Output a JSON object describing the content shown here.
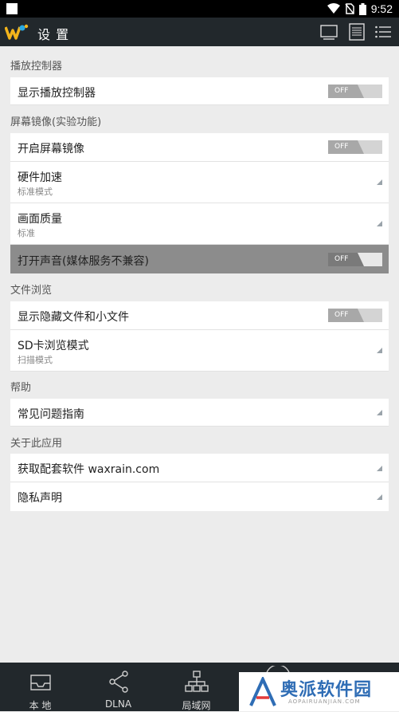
{
  "status_bar": {
    "time": "9:52"
  },
  "app_bar": {
    "title": "设 置"
  },
  "sections": [
    {
      "header": "播放控制器",
      "rows": [
        {
          "label": "显示播放控制器",
          "toggle": "OFF"
        }
      ]
    },
    {
      "header": "屏幕镜像(实验功能)",
      "rows": [
        {
          "label": "开启屏幕镜像",
          "toggle": "OFF"
        },
        {
          "label": "硬件加速",
          "sub": "标准模式"
        },
        {
          "label": "画面质量",
          "sub": "标准"
        },
        {
          "label": "打开声音(媒体服务不兼容)",
          "toggle": "OFF",
          "disabled": true
        }
      ]
    },
    {
      "header": "文件浏览",
      "rows": [
        {
          "label": "显示隐藏文件和小文件",
          "toggle": "OFF"
        },
        {
          "label": "SD卡浏览模式",
          "sub": "扫描模式"
        }
      ]
    },
    {
      "header": "帮助",
      "rows": [
        {
          "label": "常见问题指南"
        }
      ]
    },
    {
      "header": "关于此应用",
      "rows": [
        {
          "label": "获取配套软件 waxrain.com"
        },
        {
          "label": "隐私声明"
        }
      ]
    }
  ],
  "bottom_nav": {
    "local": "本 地",
    "dlna": "DLNA",
    "lan": "局域网"
  },
  "watermark": {
    "text": "奥派软件园",
    "sub": "AOPAIRUANJIAN.COM"
  },
  "colors": {
    "app_bar": "#22282c",
    "background": "#ececec",
    "row": "#ffffff",
    "disabled_row": "#8c8c8c",
    "accent_logo": "#f3b41b"
  }
}
